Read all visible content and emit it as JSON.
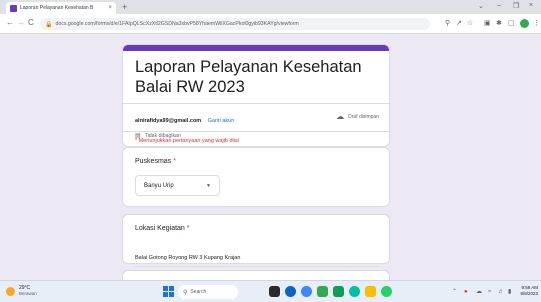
{
  "browser": {
    "tab_title": "Laporan Pelayanan Kesehatan B",
    "tab_close": "×",
    "new_tab": "+",
    "minimize": "⌄",
    "min2": "–",
    "maximize": "❐",
    "close": "×",
    "back": "←",
    "forward": "→",
    "reload": "C",
    "url": "docs.google.com/forms/d/e/1FAIpQLScXzXtl2GSDNa3xbvP58YhaemWilXGacPkol0gyib93KAYg/viewform"
  },
  "form": {
    "accent_color": "#673ab7",
    "title": "Laporan Pelayanan Kesehatan Balai RW 2023",
    "account_email": "alnirafidya99@gmail.com",
    "switch_account": "Ganti akun",
    "not_shared": "Tidak dibagikan",
    "draft_saved": "Draf disimpan",
    "required_note": "* Menunjukkan pertanyaan yang wajib diisi",
    "questions": [
      {
        "label": "Puskesmas",
        "required_mark": "*",
        "value": "Banyu Urip"
      },
      {
        "label": "Lokasi Kegiatan",
        "required_mark": "*",
        "value": "Balai Gotong Royong RW 3 Kupang Krajan"
      }
    ]
  },
  "taskbar": {
    "temperature": "29°C",
    "condition": "Berawan",
    "search_label": "Search",
    "time": "9:59 AM",
    "date": "8/8/2023"
  }
}
